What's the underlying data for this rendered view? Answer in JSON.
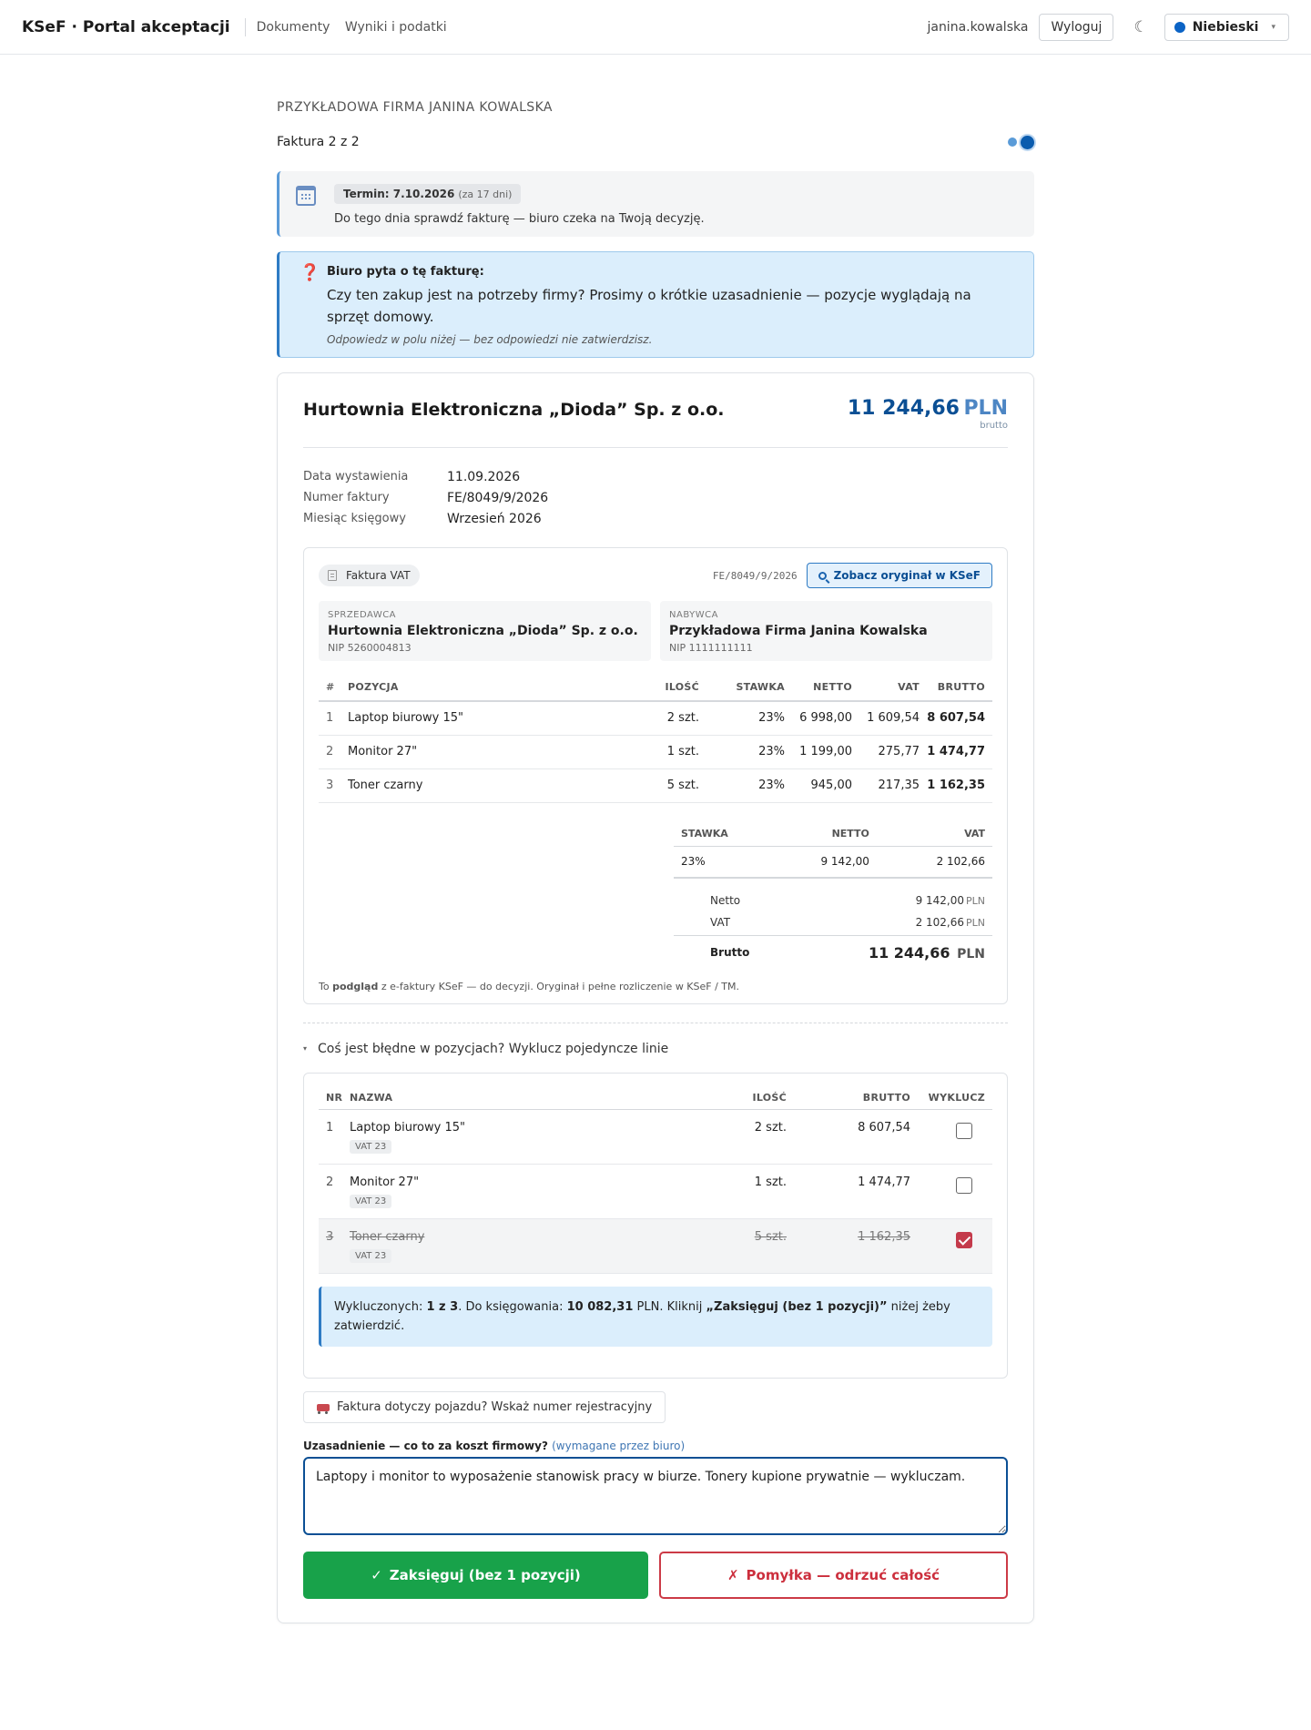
{
  "header": {
    "brand": "KSeF · Portal akceptacji",
    "nav": [
      "Dokumenty",
      "Wyniki i podatki"
    ],
    "username": "janina.kowalska",
    "logout_label": "Wyloguj",
    "moon_icon": "☾",
    "theme_label": "Niebieski",
    "theme_color": "#0b63c5"
  },
  "page": {
    "company": "PRZYKŁADOWA FIRMA JANINA KOWALSKA",
    "invoice_counter": "Faktura 2 z 2"
  },
  "deadline": {
    "tag": "Termin: 7.10.2026",
    "tag_sub": "(za 17 dni)",
    "text": "Do tego dnia sprawdź fakturę — biuro czeka na Twoją decyzję."
  },
  "question": {
    "icon": "❓",
    "title": "Biuro pyta o tę fakturę:",
    "text": "Czy ten zakup jest na potrzeby firmy? Prosimy o krótkie uzasadnienie — pozycje wyglądają na sprzęt domowy.",
    "hint": "Odpowiedz w polu niżej — bez odpowiedzi nie zatwierdzisz."
  },
  "invoice": {
    "seller": "Hurtownia Elektroniczna „Dioda” Sp. z o.o.",
    "amount": "11 244,66",
    "currency": "PLN",
    "amount_sub": "brutto",
    "meta": [
      {
        "label": "Data wystawienia",
        "value": "11.09.2026"
      },
      {
        "label": "Numer faktury",
        "value": "FE/8049/9/2026"
      },
      {
        "label": "Miesiąc księgowy",
        "value": "Wrzesień 2026"
      }
    ]
  },
  "preview": {
    "doc_type": "Faktura VAT",
    "number": "FE/8049/9/2026",
    "ksef_button": "Zobacz oryginał w KSeF",
    "seller": {
      "label": "SPRZEDAWCA",
      "name": "Hurtownia Elektroniczna „Dioda” Sp. z o.o.",
      "nip": "NIP 5260004813"
    },
    "buyer": {
      "label": "NABYWCA",
      "name": "Przykładowa Firma Janina Kowalska",
      "nip": "NIP 1111111111"
    },
    "columns": [
      "#",
      "POZYCJA",
      "ILOŚĆ",
      "STAWKA",
      "NETTO",
      "VAT",
      "BRUTTO"
    ],
    "rows": [
      {
        "nr": "1",
        "name": "Laptop biurowy 15\"",
        "qty": "2 szt.",
        "rate": "23%",
        "net": "6 998,00",
        "vat": "1 609,54",
        "gross": "8 607,54"
      },
      {
        "nr": "2",
        "name": "Monitor 27\"",
        "qty": "1 szt.",
        "rate": "23%",
        "net": "1 199,00",
        "vat": "275,77",
        "gross": "1 474,77"
      },
      {
        "nr": "3",
        "name": "Toner czarny",
        "qty": "5 szt.",
        "rate": "23%",
        "net": "945,00",
        "vat": "217,35",
        "gross": "1 162,35"
      }
    ],
    "vat_summary": {
      "columns": [
        "STAWKA",
        "NETTO",
        "VAT"
      ],
      "row": {
        "rate": "23%",
        "net": "9 142,00",
        "vat": "2 102,66"
      }
    },
    "totals": {
      "netto_label": "Netto",
      "netto": "9 142,00",
      "vat_label": "VAT",
      "vat": "2 102,66",
      "brutto_label": "Brutto",
      "brutto": "11 244,66",
      "currency": "PLN"
    },
    "note_pre": "To ",
    "note_bold": "podgląd",
    "note_post": " z e-faktury KSeF — do decyzji. Oryginał i pełne rozliczenie w KSeF / TM."
  },
  "exclude": {
    "toggle_label": "Coś jest błędne w pozycjach? Wyklucz pojedyncze linie",
    "columns": [
      "NR",
      "NAZWA",
      "ILOŚĆ",
      "BRUTTO",
      "WYKLUCZ"
    ],
    "rows": [
      {
        "nr": "1",
        "name": "Laptop biurowy 15\"",
        "vat": "VAT 23",
        "qty": "2 szt.",
        "gross": "8 607,54",
        "excluded": false
      },
      {
        "nr": "2",
        "name": "Monitor 27\"",
        "vat": "VAT 23",
        "qty": "1 szt.",
        "gross": "1 474,77",
        "excluded": false
      },
      {
        "nr": "3",
        "name": "Toner czarny",
        "vat": "VAT 23",
        "qty": "5 szt.",
        "gross": "1 162,35",
        "excluded": true
      }
    ],
    "info": {
      "t1": "Wykluczonych: ",
      "b1": "1 z 3",
      "t2": ". Do księgowania: ",
      "b2": "10 082,31",
      "t3": " PLN. Kliknij ",
      "b3": "„Zaksięguj (bez 1 pozycji)”",
      "t4": " niżej żeby zatwierdzić."
    }
  },
  "vehicle_label": "Faktura dotyczy pojazdu? Wskaż numer rejestracyjny",
  "justification": {
    "label": "Uzasadnienie — co to za koszt firmowy?",
    "required": "(wymagane przez biuro)",
    "value": "Laptopy i monitor to wyposażenie stanowisk pracy w biurze. Tonery kupione prywatnie — wykluczam."
  },
  "actions": {
    "accept_icon": "✓",
    "accept_label": "Zaksięguj (bez 1 pozycji)",
    "reject_icon": "✗",
    "reject_label": "Pomyłka — odrzuć całość"
  }
}
